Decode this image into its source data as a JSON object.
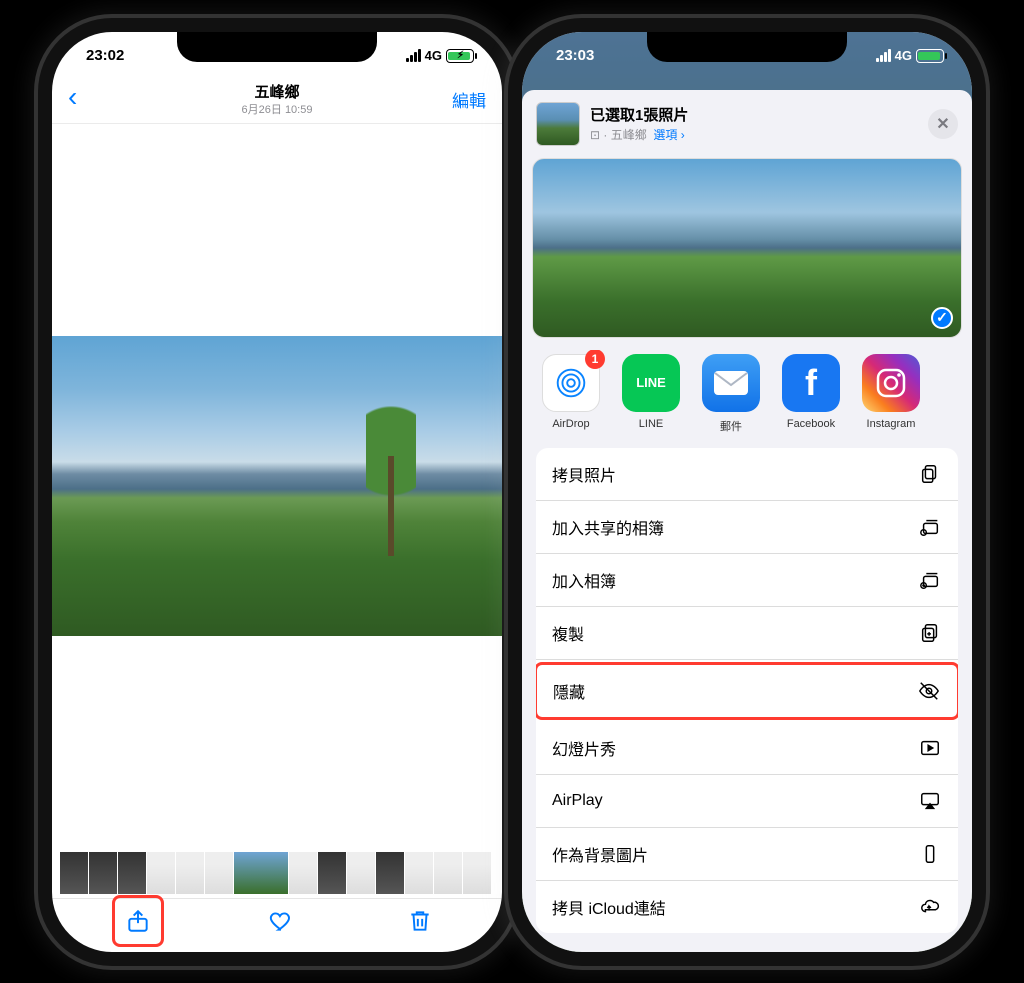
{
  "left": {
    "status": {
      "time": "23:02",
      "network": "4G"
    },
    "nav": {
      "title": "五峰鄉",
      "subtitle": "6月26日 10:59",
      "edit": "編輯"
    },
    "toolbar": {
      "share": "Share",
      "fav": "Favorite",
      "trash": "Delete"
    }
  },
  "right": {
    "status": {
      "time": "23:03",
      "network": "4G"
    },
    "sheet": {
      "title": "已選取1張照片",
      "location": "五峰鄉",
      "options_label": "選項",
      "airdrop_badge": "1"
    },
    "apps": [
      {
        "name": "AirDrop",
        "kind": "airdrop"
      },
      {
        "name": "LINE",
        "kind": "line"
      },
      {
        "name": "郵件",
        "kind": "mail"
      },
      {
        "name": "Facebook",
        "kind": "fb"
      },
      {
        "name": "Instagram",
        "kind": "ig"
      }
    ],
    "actions": [
      {
        "label": "拷貝照片",
        "icon": "copy"
      },
      {
        "label": "加入共享的相簿",
        "icon": "shared-album"
      },
      {
        "label": "加入相簿",
        "icon": "album"
      },
      {
        "label": "複製",
        "icon": "duplicate"
      },
      {
        "label": "隱藏",
        "icon": "hide",
        "highlight": true
      },
      {
        "label": "幻燈片秀",
        "icon": "slideshow"
      },
      {
        "label": "AirPlay",
        "icon": "airplay"
      },
      {
        "label": "作為背景圖片",
        "icon": "wallpaper"
      },
      {
        "label": "拷貝 iCloud連結",
        "icon": "icloud-link"
      }
    ]
  }
}
